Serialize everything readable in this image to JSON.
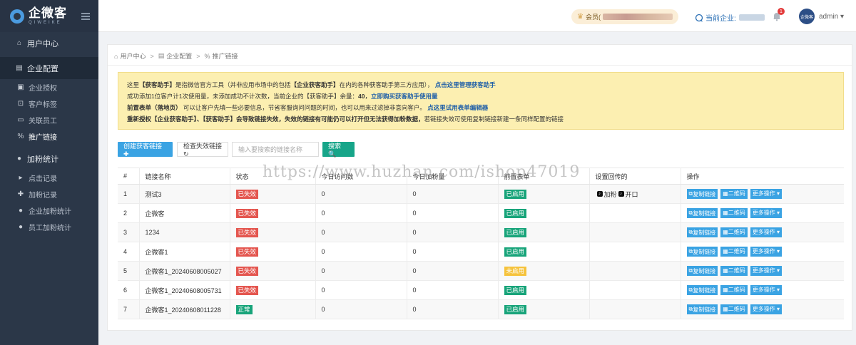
{
  "brand": {
    "title": "企微客",
    "subtitle": "QIWEIKE"
  },
  "sidebar": {
    "items": [
      {
        "label": "用户中心",
        "icon": "home-icon",
        "type": "group"
      },
      {
        "label": "企业配置",
        "icon": "building-icon",
        "type": "group",
        "active": true
      },
      {
        "label": "企业授权",
        "icon": "image-icon",
        "type": "item"
      },
      {
        "label": "客户标签",
        "icon": "tag-icon",
        "type": "item"
      },
      {
        "label": "关联员工",
        "icon": "card-icon",
        "type": "item"
      },
      {
        "label": "推广链接",
        "icon": "link-icon",
        "type": "item",
        "active": true
      },
      {
        "label": "加粉统计",
        "icon": "user-icon",
        "type": "group"
      },
      {
        "label": "点击记录",
        "icon": "cursor-icon",
        "type": "item"
      },
      {
        "label": "加粉记录",
        "icon": "user-plus-icon",
        "type": "item"
      },
      {
        "label": "企业加粉统计",
        "icon": "team-icon",
        "type": "item"
      },
      {
        "label": "员工加粉统计",
        "icon": "team-icon",
        "type": "item"
      }
    ]
  },
  "topbar": {
    "vip_label": "会员(",
    "company_label": "当前企业:",
    "notification_count": "1",
    "avatar_text": "企微客",
    "user_name": "admin ▾"
  },
  "breadcrumb": [
    "用户中心",
    "企业配置",
    "推广链接"
  ],
  "notice": {
    "line1_prefix": "这里",
    "line1_bold1": "【获客助手】",
    "line1_mid": "是指微信官方工具（并非应用市场中的包括",
    "line1_bold2": "【企业获客助手】",
    "line1_tail": "在内的各种获客助手第三方应用），",
    "line1_link": "点击这里管理获客助手",
    "line2_text": "成功添加1位客户计1次使用量，未添加成功不计次数，当前企业的【获客助手】余量：",
    "line2_value": "40",
    "line2_sep": "，",
    "line2_link": "立即购买获客助手使用量",
    "line3_bold": "前置表单（落地页）",
    "line3_text": "可以让客户先填一些必要信息，节省客服询问问题的时间，也可以用来过滤掉非意向客户。",
    "line3_link": "点这里试用表单编辑器",
    "line4_bold": "重新授权【企业获客助手】、【获客助手】会导致链接失效，失效的链接有可能仍可以打开但无法获得加粉数据，",
    "line4_text": "若链接失效可使用复制链接新建一条同样配置的链接"
  },
  "toolbar": {
    "create_label": "创建获客链接 ✚",
    "check_label": "检查失效链接 ↻",
    "search_placeholder": "输入要搜索的链接名称",
    "search_label": "搜索 🔍"
  },
  "table": {
    "headers": [
      "#",
      "链接名称",
      "状态",
      "今日访问数",
      "今日加粉量",
      "前置表单",
      "设置回传的",
      "操作"
    ],
    "rows": [
      {
        "id": "1",
        "name": "测试3",
        "status": "已失效",
        "status_color": "red",
        "visits": "0",
        "fans": "0",
        "form": "已启用",
        "form_color": "green",
        "callback": [
          "加粉",
          "开口"
        ]
      },
      {
        "id": "2",
        "name": "企微客",
        "status": "已失效",
        "status_color": "red",
        "visits": "0",
        "fans": "0",
        "form": "已启用",
        "form_color": "green",
        "callback": []
      },
      {
        "id": "3",
        "name": "1234",
        "status": "已失效",
        "status_color": "red",
        "visits": "0",
        "fans": "0",
        "form": "已启用",
        "form_color": "green",
        "callback": []
      },
      {
        "id": "4",
        "name": "企微客1",
        "status": "已失效",
        "status_color": "red",
        "visits": "0",
        "fans": "0",
        "form": "已启用",
        "form_color": "green",
        "callback": []
      },
      {
        "id": "5",
        "name": "企微客1_20240608005027",
        "status": "已失效",
        "status_color": "red",
        "visits": "0",
        "fans": "0",
        "form": "未启用",
        "form_color": "yellow",
        "callback": []
      },
      {
        "id": "6",
        "name": "企微客1_20240608005731",
        "status": "已失效",
        "status_color": "red",
        "visits": "0",
        "fans": "0",
        "form": "已启用",
        "form_color": "green",
        "callback": []
      },
      {
        "id": "7",
        "name": "企微客1_20240608011228",
        "status": "正常",
        "status_color": "green",
        "visits": "0",
        "fans": "0",
        "form": "已启用",
        "form_color": "green",
        "callback": []
      }
    ],
    "actions": {
      "copy": "复制链接",
      "qrcode": "二维码",
      "more": "更多操作 ▾"
    }
  },
  "watermark": "https://www.huzhan.com/ishop47019"
}
